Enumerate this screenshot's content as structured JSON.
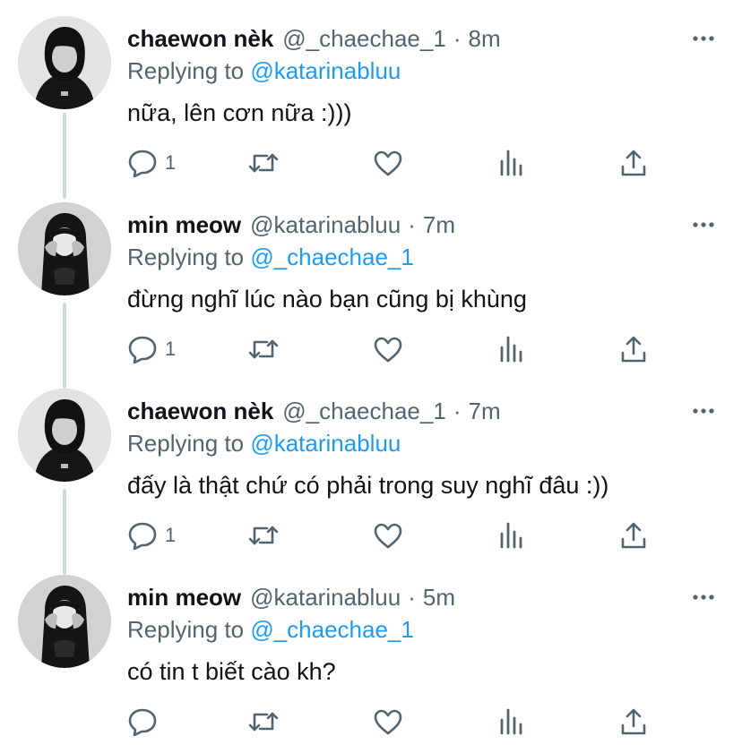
{
  "thread": {
    "replying_prefix": "Replying to",
    "tweets": [
      {
        "name": "chaewon nèk",
        "handle": "@_chaechae_1",
        "separator": "·",
        "time": "8m",
        "replying_to": "@katarinabluu",
        "text": "nữa, lên cơn nữa :)))",
        "reply_count": "1",
        "avatar": "chaewon"
      },
      {
        "name": "min meow",
        "handle": "@katarinabluu",
        "separator": "·",
        "time": "7m",
        "replying_to": "@_chaechae_1",
        "text": "đừng nghĩ lúc nào bạn cũng bị khùng",
        "reply_count": "1",
        "avatar": "minmeow"
      },
      {
        "name": "chaewon nèk",
        "handle": "@_chaechae_1",
        "separator": "·",
        "time": "7m",
        "replying_to": "@katarinabluu",
        "text": "đấy là thật chứ có phải trong suy nghĩ đâu :))",
        "reply_count": "1",
        "avatar": "chaewon"
      },
      {
        "name": "min meow",
        "handle": "@katarinabluu",
        "separator": "·",
        "time": "5m",
        "replying_to": "@_chaechae_1",
        "text": "có tin t biết cào kh?",
        "reply_count": "",
        "avatar": "minmeow"
      }
    ]
  },
  "colors": {
    "text_primary": "#0f1419",
    "text_secondary": "#536471",
    "mention": "#1d9bf0",
    "connector": "#cfd9de"
  },
  "icons": {
    "more": "more-horizontal-icon",
    "reply": "reply-icon",
    "retweet": "retweet-icon",
    "like": "heart-icon",
    "analytics": "analytics-icon",
    "share": "share-icon"
  }
}
